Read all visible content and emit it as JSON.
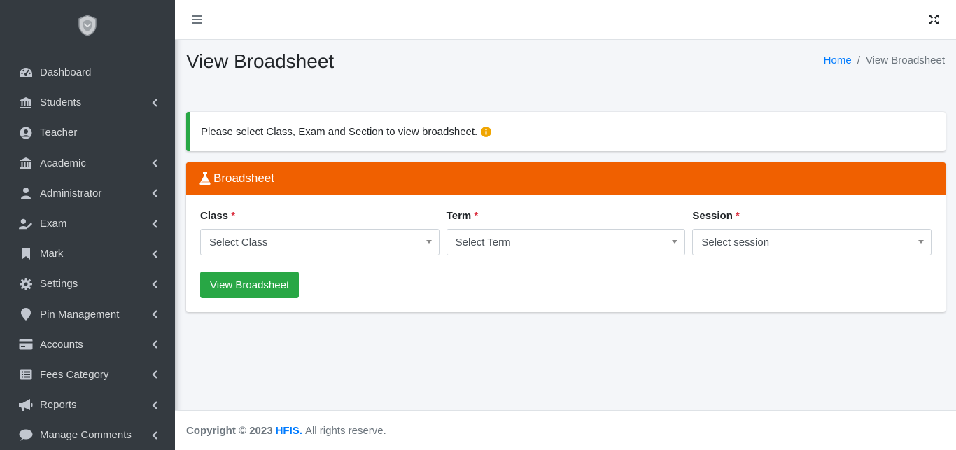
{
  "sidebar": {
    "items": [
      {
        "label": "Dashboard",
        "icon": "tachometer-icon",
        "has_children": false
      },
      {
        "label": "Students",
        "icon": "university-icon",
        "has_children": true
      },
      {
        "label": "Teacher",
        "icon": "user-circle-icon",
        "has_children": false
      },
      {
        "label": "Academic",
        "icon": "university-icon",
        "has_children": true
      },
      {
        "label": "Administrator",
        "icon": "user-icon",
        "has_children": true
      },
      {
        "label": "Exam",
        "icon": "user-edit-icon",
        "has_children": true
      },
      {
        "label": "Mark",
        "icon": "bookmark-icon",
        "has_children": true
      },
      {
        "label": "Settings",
        "icon": "gear-icon",
        "has_children": true
      },
      {
        "label": "Pin Management",
        "icon": "map-marker-icon",
        "has_children": true
      },
      {
        "label": "Accounts",
        "icon": "credit-card-icon",
        "has_children": true
      },
      {
        "label": "Fees Category",
        "icon": "list-alt-icon",
        "has_children": true
      },
      {
        "label": "Reports",
        "icon": "bullhorn-icon",
        "has_children": true
      },
      {
        "label": "Manage Comments",
        "icon": "comment-icon",
        "has_children": true
      }
    ]
  },
  "header": {
    "title": "View Broadsheet",
    "breadcrumb": {
      "home": "Home",
      "separator": "/",
      "current": "View Broadsheet"
    }
  },
  "callout": {
    "text": "Please select Class, Exam and Section to view broadsheet."
  },
  "card": {
    "title": "Broadsheet",
    "fields": [
      {
        "label": "Class",
        "required": "*",
        "placeholder": "Select Class"
      },
      {
        "label": "Term",
        "required": "*",
        "placeholder": "Select Term"
      },
      {
        "label": "Session",
        "required": "*",
        "placeholder": "Select session"
      }
    ],
    "submit_label": "View Broadsheet"
  },
  "footer": {
    "copyright": "Copyright © 2023",
    "brand": "HFIS.",
    "rest": "All rights reserve."
  },
  "colors": {
    "sidebar_bg": "#343a40",
    "card_header": "#f06000",
    "success": "#28a745",
    "link": "#007bff",
    "callout_border": "#28a745",
    "info_icon": "#f0a500"
  }
}
